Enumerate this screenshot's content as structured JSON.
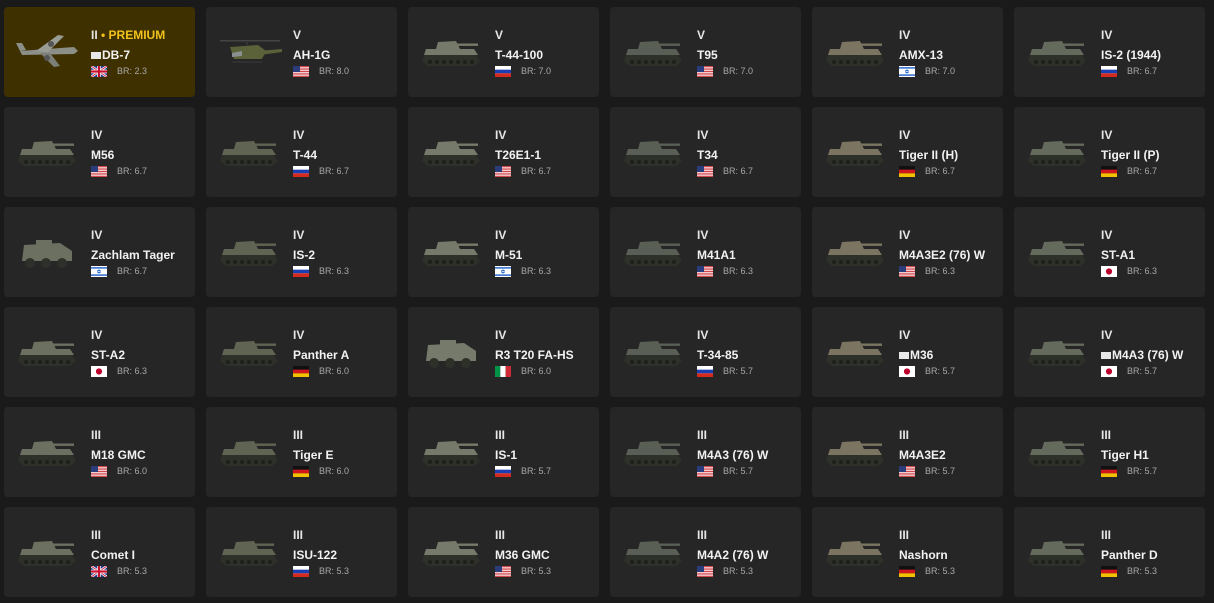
{
  "vehicles": [
    {
      "rank": "II",
      "premium_label": "PREMIUM",
      "name": "DB-7",
      "br": "BR: 2.3",
      "country": "uk",
      "icon": "aircraft-bomber-icon"
    },
    {
      "rank": "V",
      "name": "AH-1G",
      "br": "BR: 8.0",
      "country": "usa",
      "icon": "helicopter-icon"
    },
    {
      "rank": "V",
      "name": "T-44-100",
      "br": "BR: 7.0",
      "country": "ussr",
      "icon": "tank-icon"
    },
    {
      "rank": "V",
      "name": "T95",
      "br": "BR: 7.0",
      "country": "usa",
      "icon": "tank-icon"
    },
    {
      "rank": "IV",
      "name": "AMX-13",
      "br": "BR: 7.0",
      "country": "israel",
      "icon": "tank-icon"
    },
    {
      "rank": "IV",
      "name": "IS-2 (1944)",
      "br": "BR: 6.7",
      "country": "ussr",
      "icon": "tank-icon"
    },
    {
      "rank": "IV",
      "name": "M56",
      "br": "BR: 6.7",
      "country": "usa",
      "icon": "tank-icon"
    },
    {
      "rank": "IV",
      "name": "T-44",
      "br": "BR: 6.7",
      "country": "ussr",
      "icon": "tank-icon"
    },
    {
      "rank": "IV",
      "name": "T26E1-1",
      "br": "BR: 6.7",
      "country": "usa",
      "icon": "tank-icon"
    },
    {
      "rank": "IV",
      "name": "T34",
      "br": "BR: 6.7",
      "country": "usa",
      "icon": "tank-icon"
    },
    {
      "rank": "IV",
      "name": "Tiger II (H)",
      "br": "BR: 6.7",
      "country": "germany",
      "icon": "tank-icon"
    },
    {
      "rank": "IV",
      "name": "Tiger II (P)",
      "br": "BR: 6.7",
      "country": "germany",
      "icon": "tank-icon"
    },
    {
      "rank": "IV",
      "name": "Zachlam Tager",
      "br": "BR: 6.7",
      "country": "israel",
      "icon": "armored-car-icon"
    },
    {
      "rank": "IV",
      "name": "IS-2",
      "br": "BR: 6.3",
      "country": "ussr",
      "icon": "tank-icon"
    },
    {
      "rank": "IV",
      "name": "M-51",
      "br": "BR: 6.3",
      "country": "israel",
      "icon": "tank-icon"
    },
    {
      "rank": "IV",
      "name": "M41A1",
      "br": "BR: 6.3",
      "country": "usa",
      "icon": "tank-icon"
    },
    {
      "rank": "IV",
      "name": "M4A3E2 (76) W",
      "br": "BR: 6.3",
      "country": "usa",
      "icon": "tank-icon"
    },
    {
      "rank": "IV",
      "name": "ST-A1",
      "br": "BR: 6.3",
      "country": "japan",
      "icon": "tank-icon"
    },
    {
      "rank": "IV",
      "name": "ST-A2",
      "br": "BR: 6.3",
      "country": "japan",
      "icon": "tank-icon"
    },
    {
      "rank": "IV",
      "name": "Panther A",
      "br": "BR: 6.0",
      "country": "germany",
      "icon": "tank-icon"
    },
    {
      "rank": "IV",
      "name": "R3 T20 FA-HS",
      "br": "BR: 6.0",
      "country": "italy",
      "icon": "armored-car-icon"
    },
    {
      "rank": "IV",
      "name": "T-34-85",
      "br": "BR: 5.7",
      "country": "ussr",
      "icon": "tank-icon"
    },
    {
      "rank": "IV",
      "name": "M36",
      "br": "BR: 5.7",
      "country": "japan",
      "icon": "tank-icon",
      "marked": true
    },
    {
      "rank": "IV",
      "name": "M4A3 (76) W",
      "br": "BR: 5.7",
      "country": "japan",
      "icon": "tank-icon",
      "marked": true
    },
    {
      "rank": "III",
      "name": "M18 GMC",
      "br": "BR: 6.0",
      "country": "usa",
      "icon": "tank-icon"
    },
    {
      "rank": "III",
      "name": "Tiger E",
      "br": "BR: 6.0",
      "country": "germany",
      "icon": "tank-icon"
    },
    {
      "rank": "III",
      "name": "IS-1",
      "br": "BR: 5.7",
      "country": "ussr",
      "icon": "tank-icon"
    },
    {
      "rank": "III",
      "name": "M4A3 (76) W",
      "br": "BR: 5.7",
      "country": "usa",
      "icon": "tank-icon"
    },
    {
      "rank": "III",
      "name": "M4A3E2",
      "br": "BR: 5.7",
      "country": "usa",
      "icon": "tank-icon"
    },
    {
      "rank": "III",
      "name": "Tiger H1",
      "br": "BR: 5.7",
      "country": "germany",
      "icon": "tank-icon"
    },
    {
      "rank": "III",
      "name": "Comet I",
      "br": "BR: 5.3",
      "country": "uk",
      "icon": "tank-icon"
    },
    {
      "rank": "III",
      "name": "ISU-122",
      "br": "BR: 5.3",
      "country": "ussr",
      "icon": "tank-destroyer-icon"
    },
    {
      "rank": "III",
      "name": "M36 GMC",
      "br": "BR: 5.3",
      "country": "usa",
      "icon": "tank-icon"
    },
    {
      "rank": "III",
      "name": "M4A2 (76) W",
      "br": "BR: 5.3",
      "country": "usa",
      "icon": "tank-icon"
    },
    {
      "rank": "III",
      "name": "Nashorn",
      "br": "BR: 5.3",
      "country": "germany",
      "icon": "tank-destroyer-icon"
    },
    {
      "rank": "III",
      "name": "Panther D",
      "br": "BR: 5.3",
      "country": "germany",
      "icon": "tank-icon"
    }
  ],
  "colors": {
    "background": "#1a1a1a",
    "card": "#262626",
    "premium_card": "#3f3000",
    "premium_text": "#f0c21b"
  }
}
